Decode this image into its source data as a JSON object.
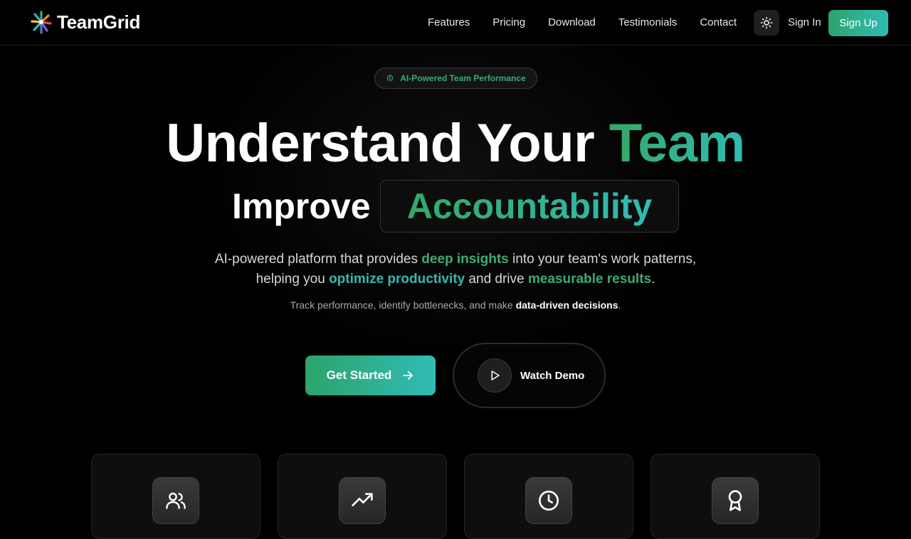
{
  "brand": {
    "name": "TeamGrid"
  },
  "nav": {
    "links": [
      "Features",
      "Pricing",
      "Download",
      "Testimonials",
      "Contact"
    ],
    "sign_in": "Sign In",
    "sign_up": "Sign Up"
  },
  "hero": {
    "badge": "AI-Powered Team Performance",
    "headline_prefix": "Understand Your",
    "headline_highlight": "Team",
    "improve_label": "Improve",
    "rotating_word": "Accountability",
    "description": {
      "p1": "AI-powered platform that provides ",
      "h1": "deep insights",
      "p2": " into your team's work patterns, helping you ",
      "h2": "optimize productivity",
      "p3": " and drive ",
      "h3": "measurable results",
      "p4": "."
    },
    "subtext": {
      "p1": "Track performance, identify bottlenecks, and make ",
      "bold": "data-driven decisions",
      "p2": "."
    },
    "cta_primary": "Get Started",
    "cta_secondary": "Watch Demo"
  },
  "feature_cards": [
    {
      "icon": "users-icon"
    },
    {
      "icon": "trending-up-icon"
    },
    {
      "icon": "clock-icon"
    },
    {
      "icon": "award-icon"
    }
  ],
  "colors": {
    "accent_green": "#35a866",
    "accent_teal": "#2fbcb5",
    "background": "#000000"
  }
}
